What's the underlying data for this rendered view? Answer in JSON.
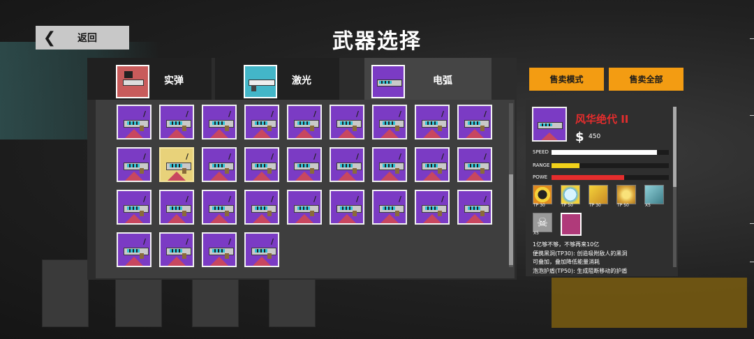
{
  "header": {
    "back_label": "返回",
    "back_icon": "chevron-left-icon",
    "title": "武器选择"
  },
  "tabs": [
    {
      "label": "实弹",
      "icon": "bullet-gun-icon",
      "color": "#c85b5b",
      "active": false
    },
    {
      "label": "激光",
      "icon": "laser-gun-icon",
      "color": "#43b6c8",
      "active": false
    },
    {
      "label": "电弧",
      "icon": "arc-gun-icon",
      "color": "#7b3bc4",
      "active": true
    }
  ],
  "weapon_grid": {
    "rows": 4,
    "per_row": [
      9,
      9,
      9,
      4
    ],
    "selected_index": 10,
    "card_color": "#7b3bc4"
  },
  "actions": {
    "sell_mode": "售卖模式",
    "sell_all": "售卖全部"
  },
  "detail": {
    "name": "风华绝代 II",
    "price_icon": "$",
    "price": "450",
    "stats": [
      {
        "label": "SPEED",
        "value": 0.9,
        "color": "#ffffff"
      },
      {
        "label": "RANGE",
        "value": 0.24,
        "color": "#f1d11a"
      },
      {
        "label": "POWE",
        "value": 0.62,
        "color": "#e52d2d"
      }
    ],
    "skills": [
      {
        "icon": "black-hole-skill-icon",
        "tp": "TP 30"
      },
      {
        "icon": "bubble-shield-skill-icon",
        "tp": "TP 50"
      },
      {
        "icon": "rocket-skill-icon",
        "tp": "TP 30"
      },
      {
        "icon": "gold-ring-skill-icon",
        "tp": "TP 50"
      },
      {
        "icon": "wave-skill-icon",
        "tp": "X5"
      },
      {
        "icon": "skull-skill-icon",
        "tp": "X5"
      },
      {
        "icon": "boss-badge-icon",
        "tp": ""
      }
    ],
    "description": [
      "1亿够不够，不够再来10亿",
      "便携黑洞(TP30): 创造吸附敌人的黑洞",
      "可叠加，叠加降低能量消耗",
      "泡泡护盾(TP50): 生成阻断移动的护盾"
    ]
  }
}
